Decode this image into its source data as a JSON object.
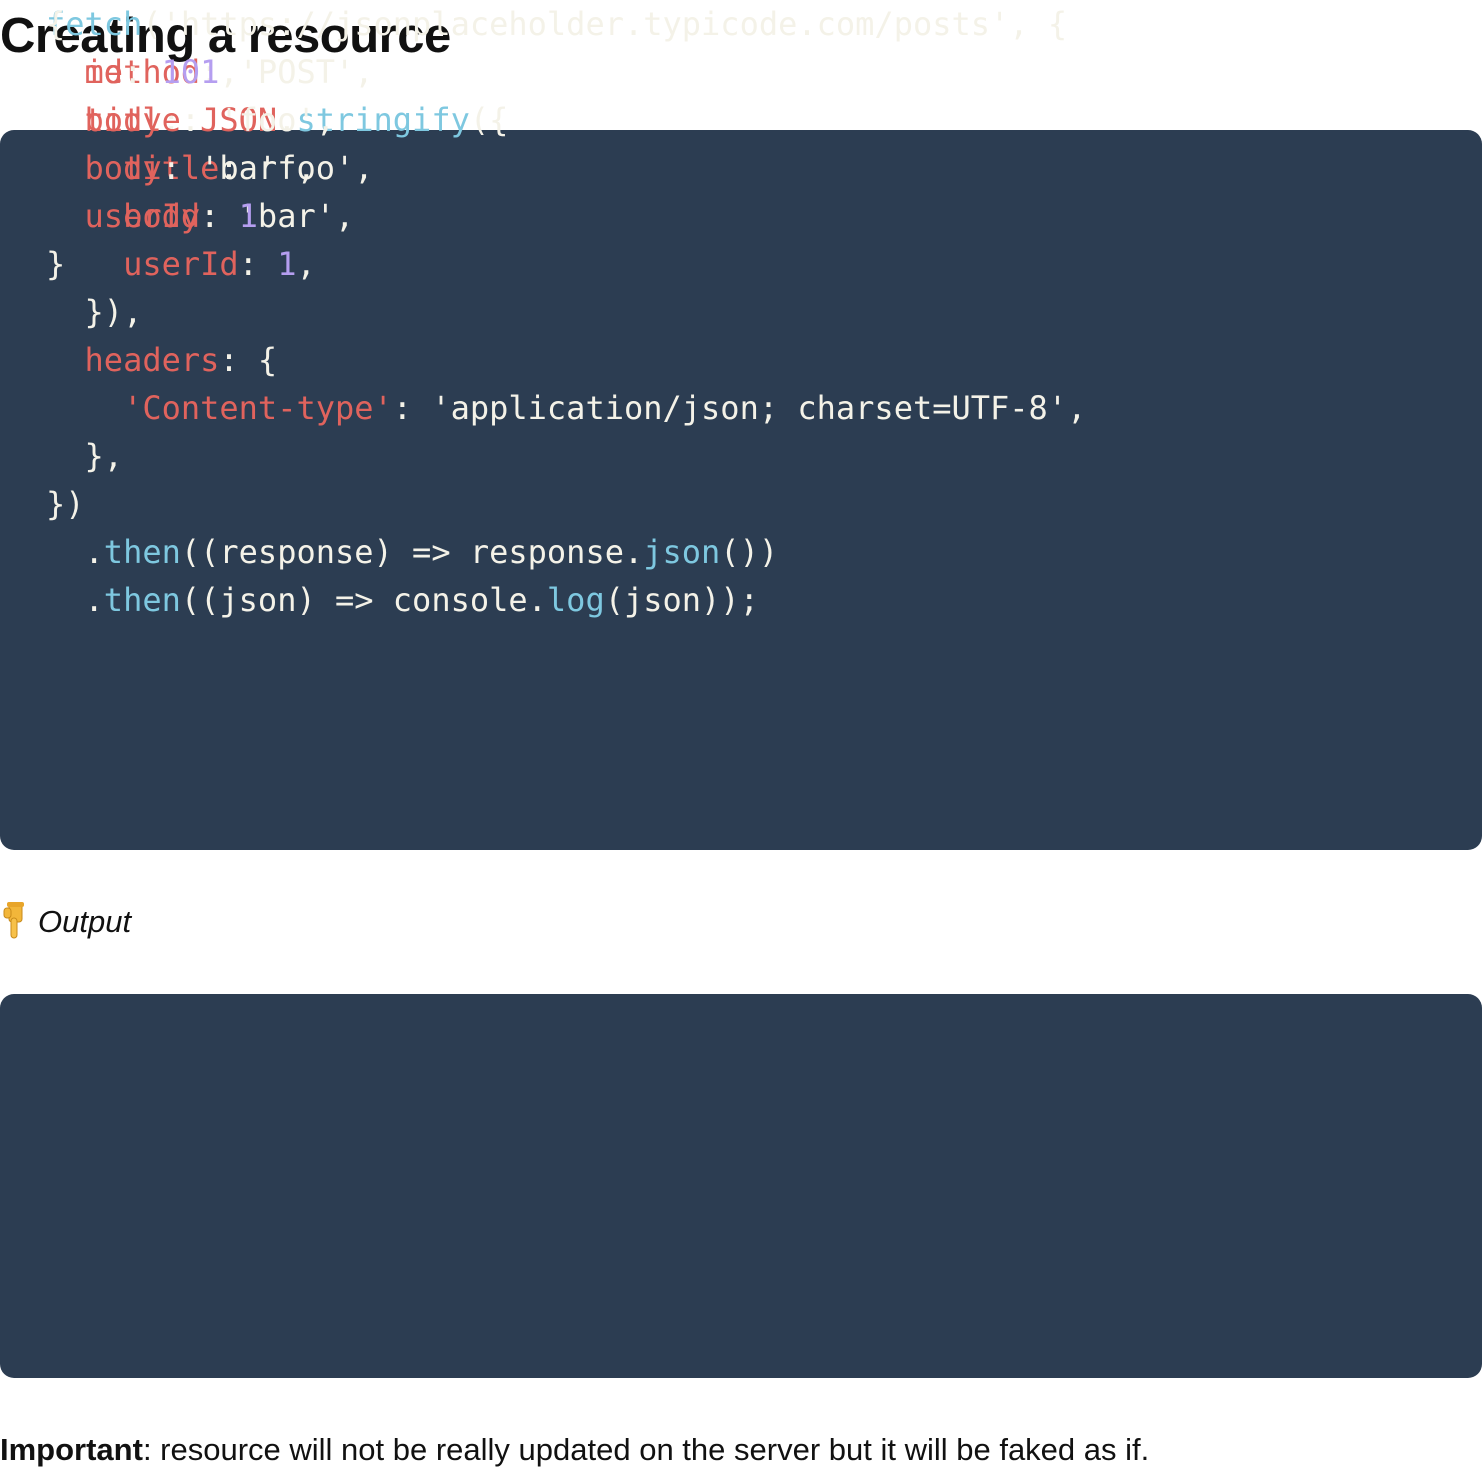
{
  "page_title": "Creating a resource",
  "request_code": {
    "lines": [
      [
        {
          "t": "fetch",
          "k": "fn"
        },
        {
          "t": "('https://jsonplaceholder.typicode.com/posts', {",
          "k": "str"
        }
      ],
      [
        {
          "t": "  "
        },
        {
          "t": "method",
          "k": "prop"
        },
        {
          "t": ": 'POST',",
          "k": "str"
        }
      ],
      [
        {
          "t": "  "
        },
        {
          "t": "body",
          "k": "prop"
        },
        {
          "t": ": "
        },
        {
          "t": "JSON",
          "k": "prop"
        },
        {
          "t": "."
        },
        {
          "t": "stringify",
          "k": "fn"
        },
        {
          "t": "({"
        }
      ],
      [
        {
          "t": "    "
        },
        {
          "t": "title",
          "k": "prop"
        },
        {
          "t": ": 'foo',",
          "k": "str"
        }
      ],
      [
        {
          "t": "    "
        },
        {
          "t": "body",
          "k": "prop"
        },
        {
          "t": ": 'bar',",
          "k": "str"
        }
      ],
      [
        {
          "t": "    "
        },
        {
          "t": "userId",
          "k": "prop"
        },
        {
          "t": ": "
        },
        {
          "t": "1",
          "k": "num"
        },
        {
          "t": ","
        }
      ],
      [
        {
          "t": "  }),"
        }
      ],
      [
        {
          "t": "  "
        },
        {
          "t": "headers",
          "k": "prop"
        },
        {
          "t": ": {"
        }
      ],
      [
        {
          "t": "    "
        },
        {
          "t": "'Content-type'",
          "k": "prop"
        },
        {
          "t": ": 'application/json; charset=UTF-8',",
          "k": "str"
        }
      ],
      [
        {
          "t": "  },"
        }
      ],
      [
        {
          "t": "})"
        }
      ],
      [
        {
          "t": "  ."
        },
        {
          "t": "then",
          "k": "fn"
        },
        {
          "t": "((response) => response."
        },
        {
          "t": "json",
          "k": "fn"
        },
        {
          "t": "())"
        }
      ],
      [
        {
          "t": "  ."
        },
        {
          "t": "then",
          "k": "fn"
        },
        {
          "t": "((json) => console."
        },
        {
          "t": "log",
          "k": "fn"
        },
        {
          "t": "(json));"
        }
      ]
    ]
  },
  "output_label": "Output",
  "output_icon": "pointing-down-hand-icon",
  "response_code": {
    "lines": [
      [
        {
          "t": "{"
        }
      ],
      [
        {
          "t": "  "
        },
        {
          "t": "id",
          "k": "prop"
        },
        {
          "t": ": "
        },
        {
          "t": "101",
          "k": "num"
        },
        {
          "t": ","
        }
      ],
      [
        {
          "t": "  "
        },
        {
          "t": "title",
          "k": "prop"
        },
        {
          "t": ": 'foo',",
          "k": "str"
        }
      ],
      [
        {
          "t": "  "
        },
        {
          "t": "body",
          "k": "prop"
        },
        {
          "t": ": 'bar',",
          "k": "str"
        }
      ],
      [
        {
          "t": "  "
        },
        {
          "t": "userId",
          "k": "prop"
        },
        {
          "t": ": "
        },
        {
          "t": "1",
          "k": "num"
        }
      ],
      [
        {
          "t": "}"
        }
      ]
    ]
  },
  "note": {
    "bold": "Important",
    "text": ": resource will not be really updated on the server but it will be faked as if."
  },
  "colors": {
    "code_background": "#2c3d52",
    "function": "#7ec8e0",
    "property": "#e0635d",
    "number": "#b59ef0",
    "text": "#f4f2e8"
  }
}
